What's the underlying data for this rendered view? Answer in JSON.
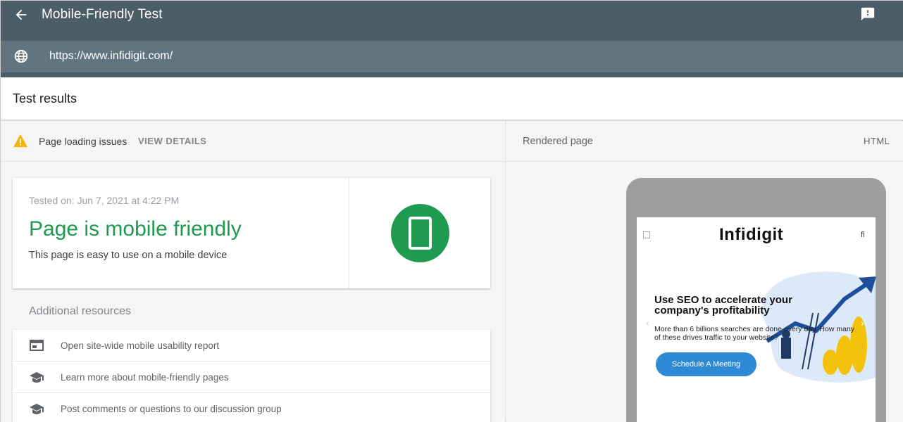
{
  "appbar": {
    "title": "Mobile-Friendly Test"
  },
  "urlbar": {
    "url": "https://www.infidigit.com/"
  },
  "results": {
    "title": "Test results"
  },
  "issues": {
    "label": "Page loading issues",
    "view_details": "VIEW DETAILS"
  },
  "summary": {
    "tested_on": "Tested on: Jun 7, 2021 at 4:22 PM",
    "headline": "Page is mobile friendly",
    "description": "This page is easy to use on a mobile device"
  },
  "additional": {
    "title": "Additional resources",
    "items": [
      {
        "label": "Open site-wide mobile usability report",
        "icon": "browser-window-icon"
      },
      {
        "label": "Learn more about mobile-friendly pages",
        "icon": "graduation-cap-icon"
      },
      {
        "label": "Post comments or questions to our discussion group",
        "icon": "graduation-cap-icon"
      }
    ]
  },
  "rendered": {
    "title": "Rendered page",
    "html_tab": "HTML",
    "site": {
      "logo": "Infidigit",
      "search_glyph": "fl",
      "headline": "Use SEO to accelerate your company's profitability",
      "subtext": "More than 6 billions searches are done every day. How many of these drives traffic to your website?",
      "cta": "Schedule A Meeting"
    }
  },
  "colors": {
    "appbar": "#4b5d67",
    "urlbar": "#617480",
    "success_green": "#1e9b50",
    "warning": "#f4b400",
    "cta_blue": "#2f8ad6"
  }
}
